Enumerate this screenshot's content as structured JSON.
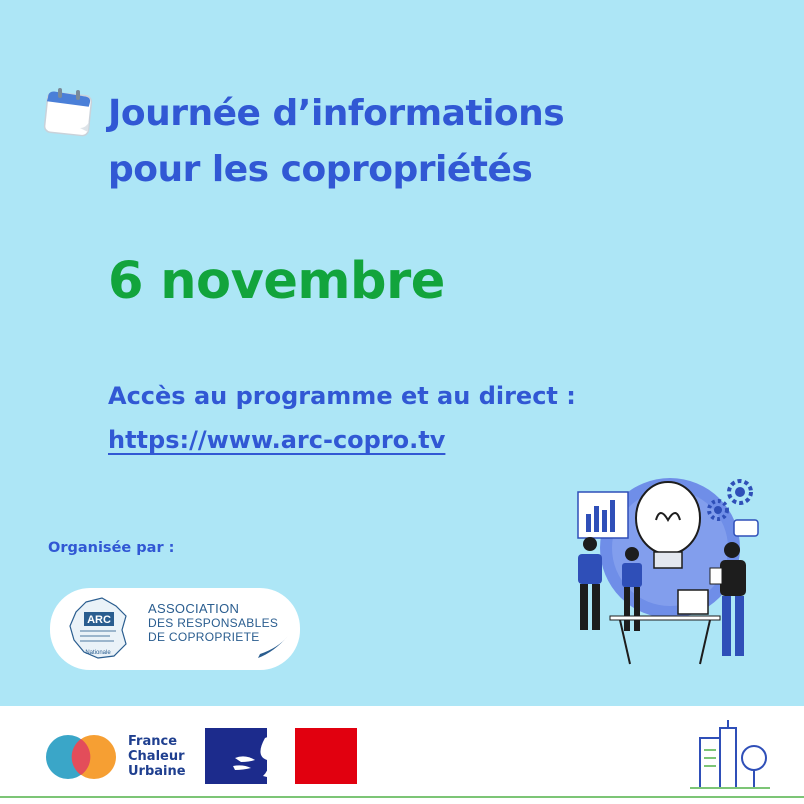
{
  "header": {
    "title_line1": "Journée d’informations",
    "title_line2": "pour les copropriétés"
  },
  "event": {
    "date": "6 novembre"
  },
  "access": {
    "label": "Accès au programme et au direct :",
    "link": "https://www.arc-copro.tv"
  },
  "organiser": {
    "label": "Organisée par :",
    "logo_letters": "ARC",
    "logo_small_text": "Nationale",
    "name_line1": "ASSOCIATION",
    "name_line2": "DES RESPONSABLES",
    "name_line3": "DE COPROPRIETE"
  },
  "footer": {
    "fcu_line1": "France",
    "fcu_line2": "Chaleur",
    "fcu_line3": "Urbaine"
  },
  "colors": {
    "background": "#ade6f6",
    "title": "#3158d4",
    "date": "#12a43c",
    "footer_line": "#7cc576"
  },
  "icons": {
    "calendar": "calendar-icon",
    "lightbulb_team": "team-lightbulb-illustration",
    "city": "city-buildings-icon"
  }
}
